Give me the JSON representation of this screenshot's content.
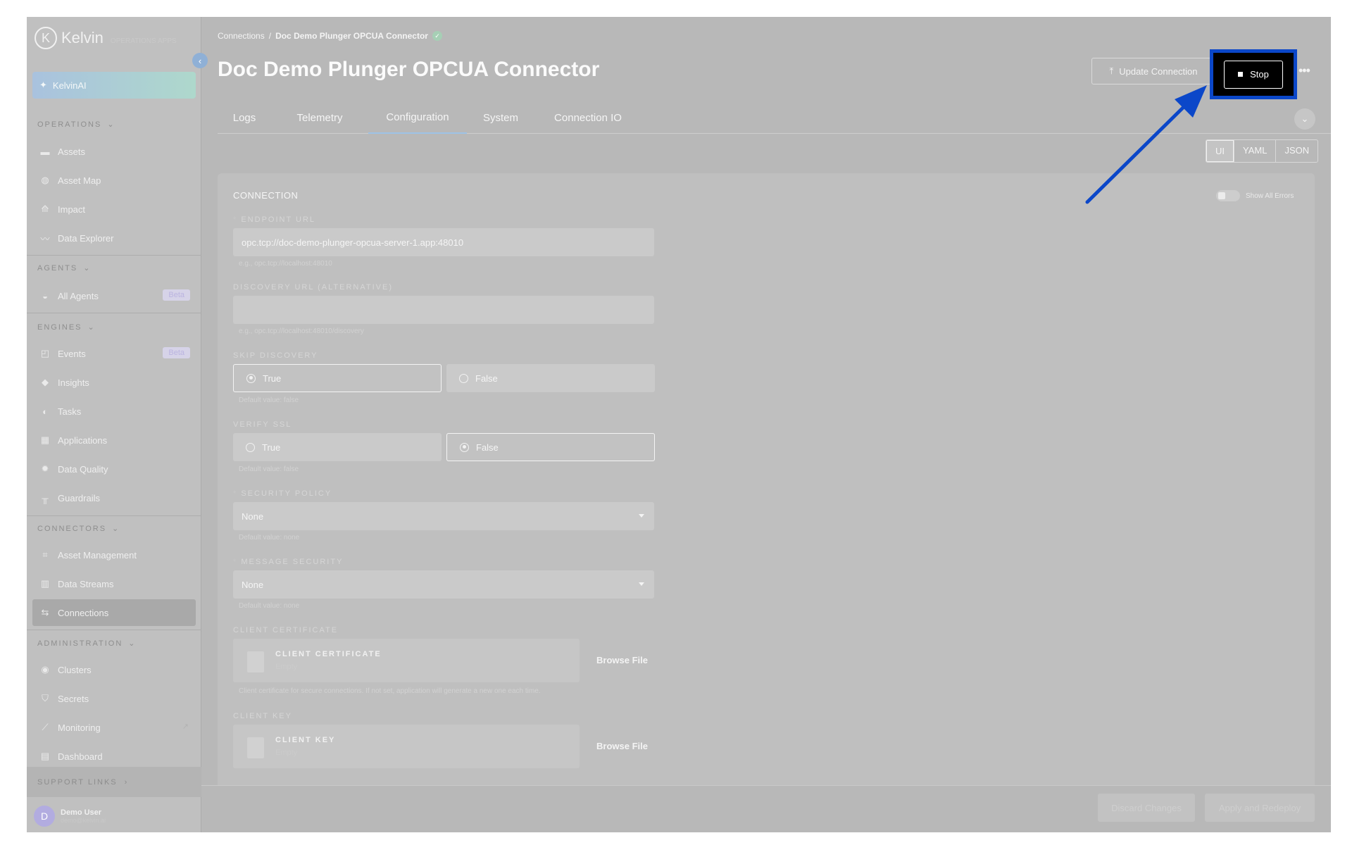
{
  "logo": {
    "text": "Kelvin",
    "mark": "K",
    "subtitle": "OPERATIONS APPS"
  },
  "sidebar": {
    "kelvinai_label": "KelvinAI",
    "sections": {
      "operations": "OPERATIONS",
      "agents": "AGENTS",
      "engines": "ENGINES",
      "connectors": "CONNECTORS",
      "administration": "ADMINISTRATION"
    },
    "items": {
      "assets": "Assets",
      "asset_map": "Asset Map",
      "impact": "Impact",
      "data_explorer": "Data Explorer",
      "all_agents": "All Agents",
      "events": "Events",
      "insights": "Insights",
      "tasks": "Tasks",
      "applications": "Applications",
      "data_quality": "Data Quality",
      "guardrails": "Guardrails",
      "asset_management": "Asset Management",
      "data_streams": "Data Streams",
      "connections": "Connections",
      "clusters": "Clusters",
      "secrets": "Secrets",
      "monitoring": "Monitoring",
      "dashboard": "Dashboard"
    },
    "beta_label": "Beta",
    "support_links": "SUPPORT LINKS",
    "user": {
      "initial": "D",
      "name": "Demo User",
      "email": "demo@kelvin.ai"
    }
  },
  "header": {
    "breadcrumb_root": "Connections",
    "breadcrumb_sep": "/",
    "breadcrumb_current": "Doc Demo Plunger OPCUA Connector",
    "title": "Doc Demo Plunger OPCUA Connector",
    "update_label": "Update Connection",
    "stop_label": "Stop",
    "more": "•••"
  },
  "tabs": [
    "Logs",
    "Telemetry",
    "Configuration",
    "System",
    "Connection IO"
  ],
  "active_tab": "Configuration",
  "view_toggle": [
    "UI",
    "YAML",
    "JSON"
  ],
  "form": {
    "section_title": "CONNECTION",
    "show_all_errors": "Show All Errors",
    "endpoint_url": {
      "label": "ENDPOINT URL",
      "value": "opc.tcp://doc-demo-plunger-opcua-server-1.app:48010",
      "hint": "e.g., opc.tcp://localhost:48010"
    },
    "discovery_url": {
      "label": "DISCOVERY URL (ALTERNATIVE)",
      "value": "",
      "hint": "e.g., opc.tcp://localhost:48010/discovery"
    },
    "skip_discovery": {
      "label": "SKIP DISCOVERY",
      "options": [
        "True",
        "False"
      ],
      "selected": "True",
      "hint": "Default value: false"
    },
    "verify_ssl": {
      "label": "VERIFY SSL",
      "options": [
        "True",
        "False"
      ],
      "selected": "False",
      "hint": "Default value: false"
    },
    "security_policy": {
      "label": "SECURITY POLICY",
      "value": "None",
      "hint": "Default value: none"
    },
    "message_security": {
      "label": "MESSAGE SECURITY",
      "value": "None",
      "hint": "Default value: none"
    },
    "client_certificate": {
      "label": "CLIENT CERTIFICATE",
      "box_title": "CLIENT CERTIFICATE",
      "empty": "Empty",
      "browse": "Browse File",
      "hint": "Client certificate for secure connections. If not set, application will generate a new one each time."
    },
    "client_key": {
      "label": "CLIENT KEY",
      "box_title": "CLIENT KEY",
      "empty": "Empty",
      "browse": "Browse File"
    }
  },
  "footer": {
    "discard_label": "Discard Changes",
    "apply_label": "Apply and Redeploy"
  }
}
